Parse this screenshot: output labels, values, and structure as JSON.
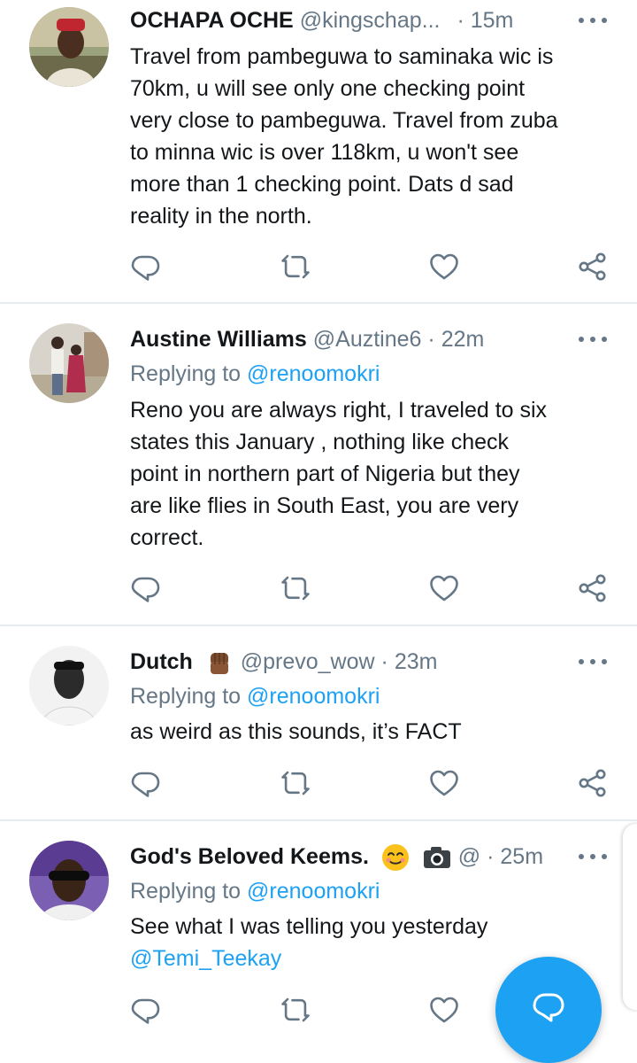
{
  "tweets": [
    {
      "name": "OCHAPA OCHE",
      "handle": "@kingschap...",
      "time": "15m",
      "replying_prefix": "",
      "replying_handle": "",
      "body_lines": [
        "Travel from pambeguwa to saminaka wic is",
        "70km, u will see only one checking point",
        "very close to pambeguwa. Travel from zuba",
        "to minna wic is over 118km, u won't see",
        "more than 1 checking point. Dats d sad",
        "reality in the north."
      ],
      "link": ""
    },
    {
      "name": "Austine Williams",
      "handle": "@Auztine6",
      "time": "22m",
      "replying_prefix": "Replying to",
      "replying_handle": "@renoomokri",
      "body_lines": [
        "Reno you are always right, I traveled to six",
        "states this January , nothing like check",
        "point in northern part of Nigeria  but they",
        "are like flies in South East, you are very",
        "correct."
      ],
      "link": ""
    },
    {
      "name": "Dutch",
      "handle": "@prevo_wow",
      "time": "23m",
      "replying_prefix": "Replying to",
      "replying_handle": "@renoomokri",
      "body_lines": [
        "as weird as this sounds, it’s FACT"
      ],
      "link": ""
    },
    {
      "name": "God's Beloved Keems.",
      "handle": "@",
      "time": "25m",
      "replying_prefix": "Replying to",
      "replying_handle": "@renoomokri",
      "body_lines": [
        "See what I was telling you yesterday"
      ],
      "link": "@Temi_Teekay"
    }
  ],
  "separator": "·",
  "icons": {
    "reply": "reply-icon",
    "retweet": "retweet-icon",
    "like": "heart-icon",
    "share": "share-icon",
    "more": "more-options-icon",
    "compose": "compose-reply-icon",
    "fist_emoji": "raised-fist-emoji",
    "smile_emoji": "smiling-face-emoji",
    "camera_emoji": "camera-emoji"
  },
  "colors": {
    "text": "#14171a",
    "secondary": "#657786",
    "accent": "#1da1f2",
    "divider": "#e6ecf0"
  }
}
